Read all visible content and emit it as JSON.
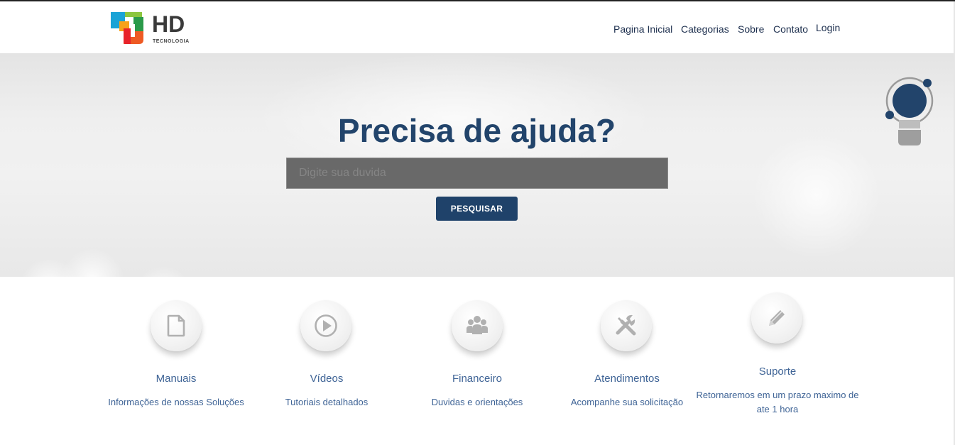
{
  "logo": {
    "name": "HD",
    "subtitle": "TECNOLOGIA"
  },
  "nav": [
    {
      "label": "Pagina Inicial"
    },
    {
      "label": "Categorias"
    },
    {
      "label": "Sobre"
    },
    {
      "label": "Contato"
    },
    {
      "label": "Login"
    }
  ],
  "hero": {
    "title": "Precisa de ajuda?",
    "search_placeholder": "Digite sua duvida",
    "search_button": "PESQUISAR",
    "decoration_icon": "lightbulb-icon"
  },
  "features": [
    {
      "icon": "document-icon",
      "title": "Manuais",
      "desc": "Informações de nossas Soluções"
    },
    {
      "icon": "play-icon",
      "title": "Vídeos",
      "desc": "Tutoriais detalhados"
    },
    {
      "icon": "users-icon",
      "title": "Financeiro",
      "desc": "Duvidas e orientações"
    },
    {
      "icon": "tools-icon",
      "title": "Atendimentos",
      "desc": "Acompanhe sua solicitação"
    },
    {
      "icon": "pencil-icon",
      "title": "Suporte",
      "desc": "Retornaremos em um prazo maximo de ate 1 hora"
    }
  ],
  "colors": {
    "primary": "#1f426a",
    "title": "#22446b",
    "link": "#3f6496",
    "nav": "#1d2f4e"
  }
}
